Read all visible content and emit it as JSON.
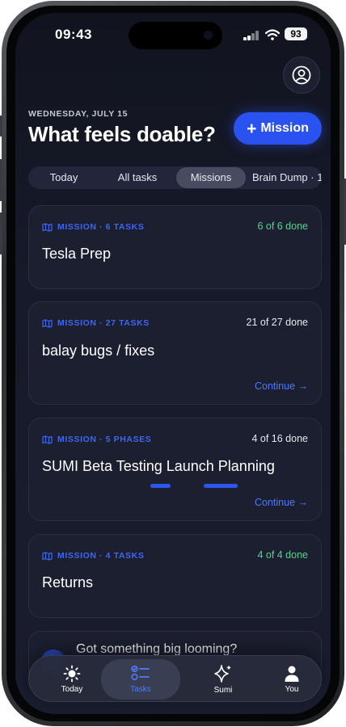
{
  "status_bar": {
    "time": "09:43",
    "battery": "93"
  },
  "header": {
    "date": "WEDNESDAY, JULY 15",
    "title": "What feels doable?",
    "add_mission_label": "Mission"
  },
  "tabs": [
    {
      "label": "Today",
      "active": false
    },
    {
      "label": "All tasks",
      "active": false
    },
    {
      "label": "Missions",
      "active": true
    },
    {
      "label": "Brain Dump · 1",
      "active": false
    }
  ],
  "missions": [
    {
      "meta": "MISSION · 6 TASKS",
      "title": "Tesla Prep",
      "status": "6 of 6 done",
      "complete": true
    },
    {
      "meta": "MISSION · 27 TASKS",
      "title": "balay bugs / fixes",
      "status": "21 of 27 done",
      "complete": false,
      "continue_label": "Continue →"
    },
    {
      "meta": "MISSION · 5 PHASES",
      "title": "SUMI Beta Testing Launch Planning",
      "status": "4 of 16 done",
      "complete": false,
      "continue_label": "Continue →"
    },
    {
      "meta": "MISSION · 4 TASKS",
      "title": "Returns",
      "status": "4 of 4 done",
      "complete": true
    }
  ],
  "cta": {
    "text": "Got something big looming?"
  },
  "nav": [
    {
      "label": "Today",
      "icon": "sun-icon",
      "active": false
    },
    {
      "label": "Tasks",
      "icon": "checklist-icon",
      "active": true
    },
    {
      "label": "Sumi",
      "icon": "sparkles-icon",
      "active": false
    },
    {
      "label": "You",
      "icon": "person-icon",
      "active": false
    }
  ],
  "colors": {
    "accent": "#2a52f0",
    "done_green": "#5ad28f",
    "link_blue": "#4a7bff",
    "background": "#171a2a"
  }
}
